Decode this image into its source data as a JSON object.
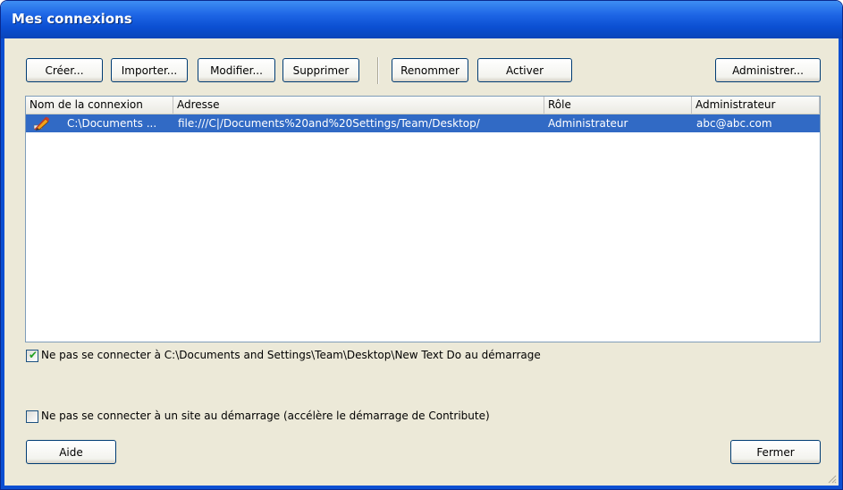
{
  "window": {
    "title": "Mes connexions"
  },
  "toolbar": {
    "create_label": "Créer...",
    "import_label": "Importer...",
    "modify_label": "Modifier...",
    "delete_label": "Supprimer",
    "rename_label": "Renommer",
    "activate_label": "Activer",
    "administer_label": "Administrer..."
  },
  "table": {
    "columns": [
      "Nom de la connexion",
      "Adresse",
      "Rôle",
      "Administrateur"
    ],
    "rows": [
      {
        "name": "C:\\Documents ...",
        "address": "file:///C|/Documents%20and%20Settings/Team/Desktop/",
        "role": "Administrateur",
        "admin": "abc@abc.com",
        "icon": "pencil-site-icon",
        "selected": true
      }
    ]
  },
  "options": {
    "no_connect_current": {
      "label": "Ne pas se connecter à C:\\Documents and Settings\\Team\\Desktop\\New Text Do au démarrage",
      "checked": true
    },
    "no_connect_site": {
      "label": "Ne pas se connecter à un site au démarrage (accélère le démarrage de Contribute)",
      "checked": false
    }
  },
  "footer": {
    "help_label": "Aide",
    "close_label": "Fermer"
  },
  "colors": {
    "titlebar": "#0b4fd2",
    "selection": "#316ac5",
    "dialog_bg": "#ece9d8"
  }
}
